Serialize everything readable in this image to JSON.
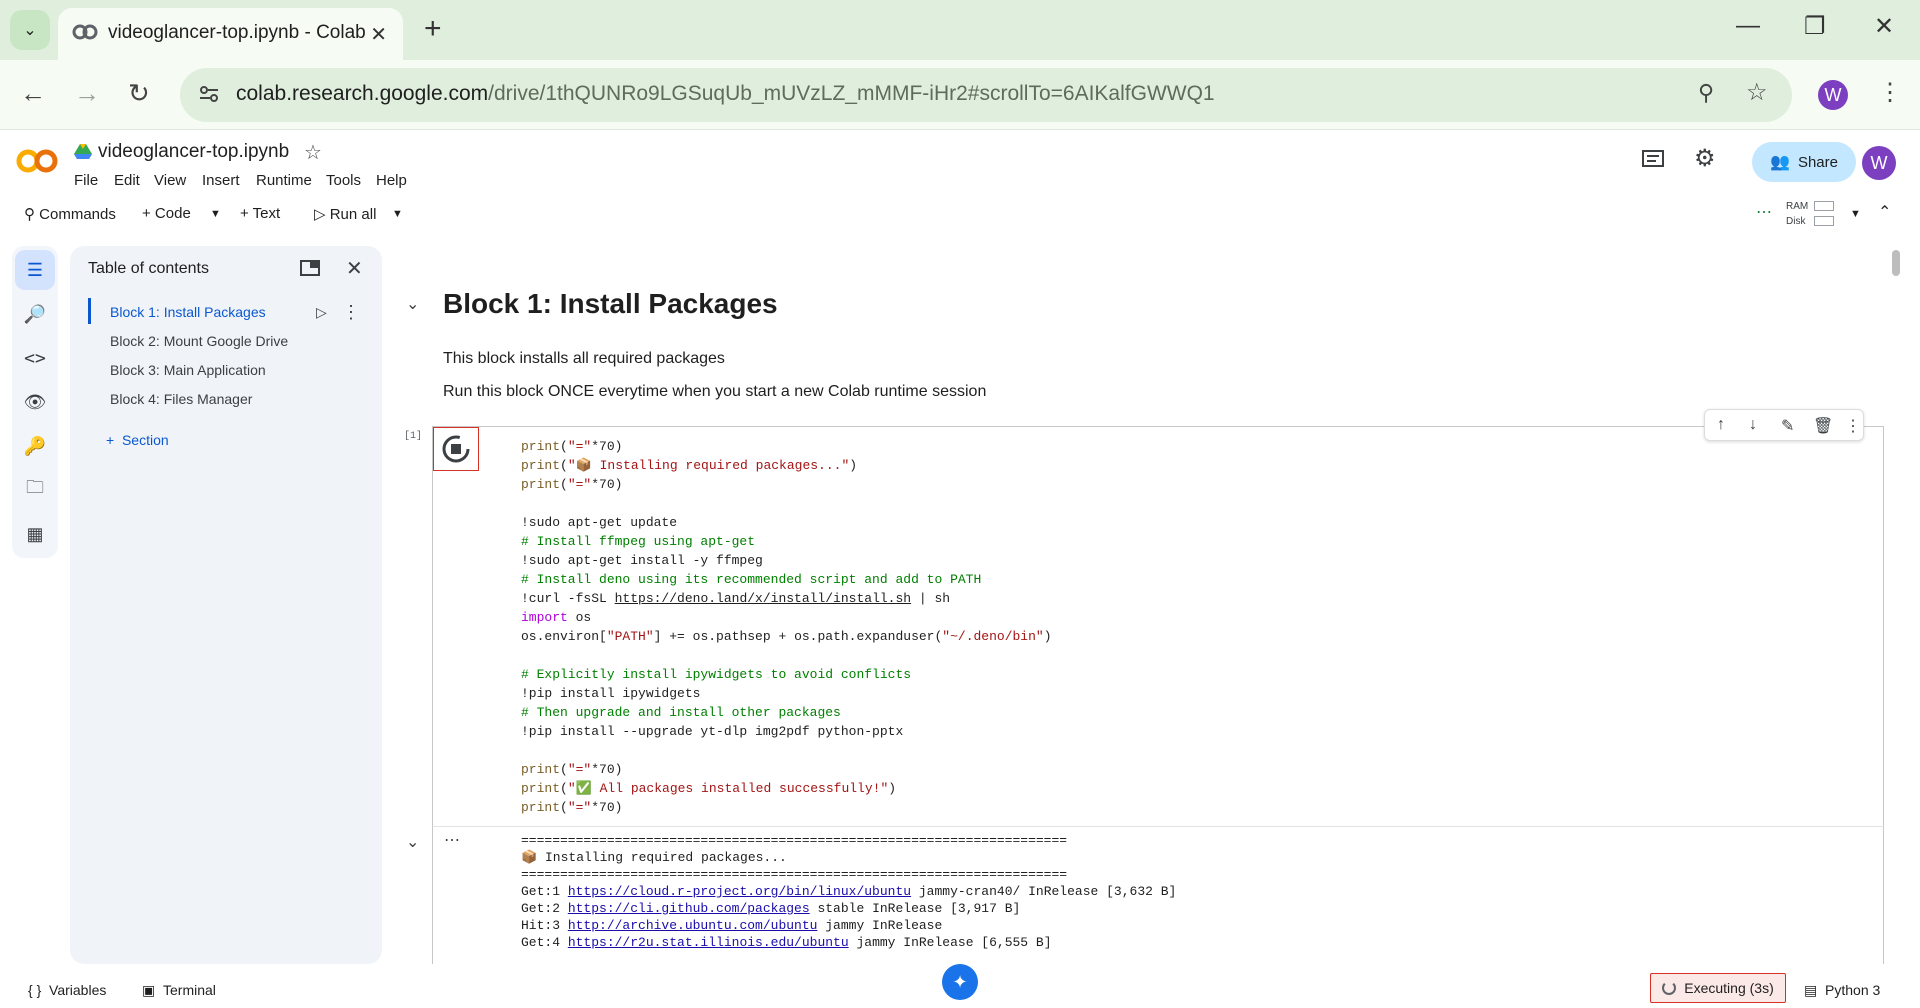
{
  "browser": {
    "tab_title": "videoglancer-top.ipynb - Colab",
    "url_host": "colab.research.google.com",
    "url_path": "/drive/1thQUNRo9LGSuqUb_mUVzLZ_mMMF-iHr2#scrollTo=6AIKalfGWWQ1",
    "profile_initial": "W"
  },
  "colab": {
    "notebook_title": "videoglancer-top.ipynb",
    "menu": [
      "File",
      "Edit",
      "View",
      "Insert",
      "Runtime",
      "Tools",
      "Help"
    ],
    "share_label": "Share",
    "user_initial": "W",
    "toolbar": {
      "commands": "Commands",
      "code": "+ Code",
      "text": "+ Text",
      "run_all": "Run all",
      "ram_label": "RAM",
      "disk_label": "Disk"
    }
  },
  "toc": {
    "title": "Table of contents",
    "items": [
      "Block 1: Install Packages",
      "Block 2: Mount Google Drive",
      "Block 3: Main Application",
      "Block 4: Files Manager"
    ],
    "add_section": "Section"
  },
  "notebook": {
    "heading": "Block 1: Install Packages",
    "md_lines": [
      "This block installs all required packages",
      "Run this block ONCE everytime when you start a new Colab runtime session"
    ],
    "cell_exec_count": "[1]",
    "output_lines": [
      "======================================================================",
      "📦 Installing required packages...",
      "======================================================================"
    ],
    "apt_lines": [
      {
        "prefix": "Get:1 ",
        "link": "https://cloud.r-project.org/bin/linux/ubuntu",
        "suffix": " jammy-cran40/ InRelease [3,632 B]"
      },
      {
        "prefix": "Get:2 ",
        "link": "https://cli.github.com/packages",
        "suffix": " stable InRelease [3,917 B]"
      },
      {
        "prefix": "Hit:3 ",
        "link": "http://archive.ubuntu.com/ubuntu",
        "suffix": " jammy InRelease"
      },
      {
        "prefix": "Get:4 ",
        "link": "https://r2u.stat.illinois.edu/ubuntu",
        "suffix": " jammy InRelease [6,555 B]"
      }
    ]
  },
  "statusbar": {
    "variables": "Variables",
    "terminal": "Terminal",
    "executing": "Executing (3s)",
    "runtime": "Python 3"
  },
  "colors": {
    "accent": "#1a73e8",
    "running_red": "#d93025",
    "colab_orange": "#f9ab00"
  }
}
